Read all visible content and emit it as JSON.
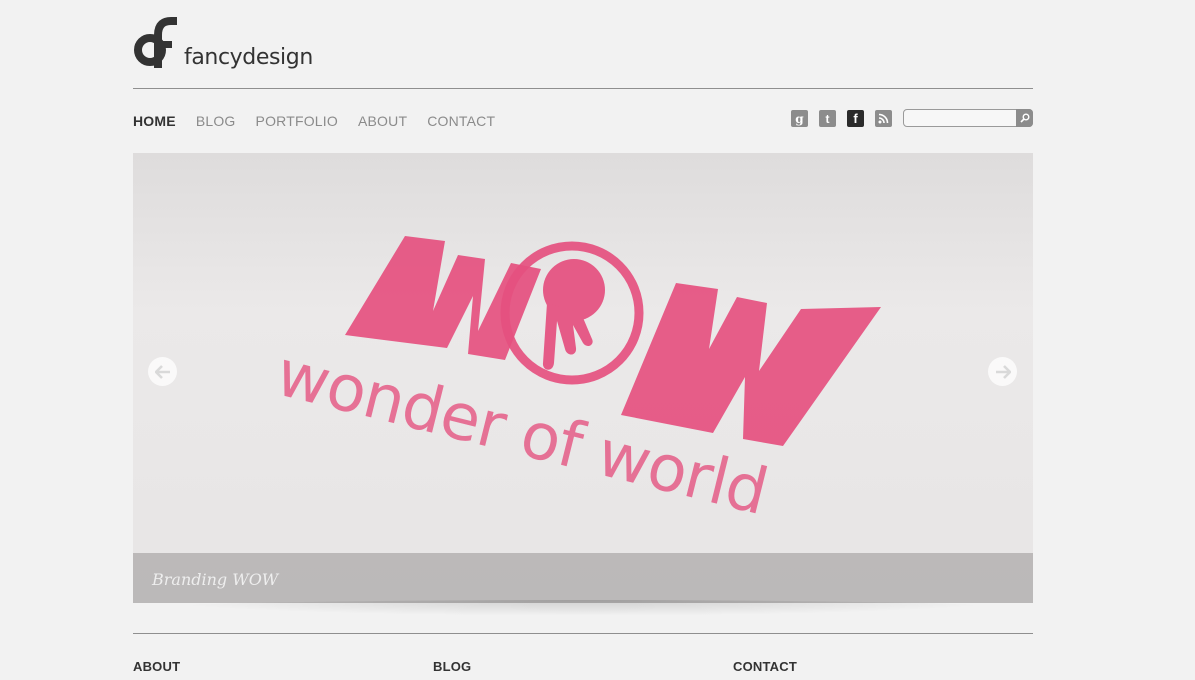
{
  "header": {
    "logo_text": "fancydesign"
  },
  "nav": {
    "items": [
      {
        "label": "HOME",
        "active": true
      },
      {
        "label": "BLOG",
        "active": false
      },
      {
        "label": "PORTFOLIO",
        "active": false
      },
      {
        "label": "ABOUT",
        "active": false
      },
      {
        "label": "CONTACT",
        "active": false
      }
    ]
  },
  "social": {
    "icons": [
      {
        "name": "google-icon",
        "glyph": "g"
      },
      {
        "name": "twitter-icon",
        "glyph": "t"
      },
      {
        "name": "facebook-icon",
        "glyph": "f"
      },
      {
        "name": "rss-icon",
        "glyph": "rss"
      }
    ]
  },
  "search": {
    "value": "",
    "placeholder": ""
  },
  "slider": {
    "caption": "Branding WOW",
    "image": {
      "headline": "WOW",
      "tagline": "wonder of world",
      "accent_color": "#e5507f"
    }
  },
  "footer": {
    "columns": [
      {
        "title": "ABOUT"
      },
      {
        "title": "BLOG"
      },
      {
        "title": "CONTACT"
      }
    ]
  },
  "colors": {
    "background": "#f2f2f2",
    "text": "#333333",
    "nav_inactive": "#8b8b8b"
  }
}
